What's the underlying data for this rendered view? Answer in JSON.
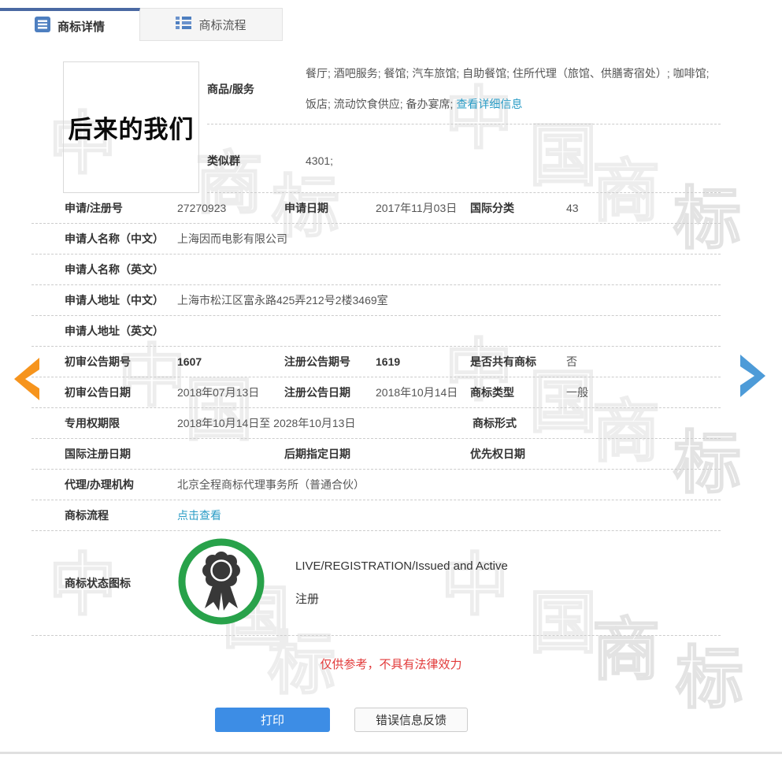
{
  "tabs": [
    {
      "label": "商标详情",
      "active": true
    },
    {
      "label": "商标流程",
      "active": false
    }
  ],
  "trademark": {
    "name": "后来的我们"
  },
  "goods": {
    "label": "商品/服务",
    "line1": "餐厅; 酒吧服务; 餐馆; 汽车旅馆; 自助餐馆; 住所代理（旅馆、供膳寄宿处）; 咖啡馆;",
    "line2": "饭店; 流动饮食供应; 备办宴席; ",
    "detail_link": "查看详细信息"
  },
  "similar_group": {
    "label": "类似群",
    "value": "4301;"
  },
  "fields": {
    "reg_no": {
      "label": "申请/注册号",
      "value": "27270923"
    },
    "app_date": {
      "label": "申请日期",
      "value": "2017年11月03日"
    },
    "intl_class": {
      "label": "国际分类",
      "value": "43"
    },
    "applicant_cn": {
      "label": "申请人名称（中文）",
      "value": "上海因而电影有限公司"
    },
    "applicant_en": {
      "label": "申请人名称（英文）",
      "value": ""
    },
    "address_cn": {
      "label": "申请人地址（中文）",
      "value": "上海市松江区富永路425弄212号2楼3469室"
    },
    "address_en": {
      "label": "申请人地址（英文）",
      "value": ""
    },
    "first_trial_no": {
      "label": "初审公告期号",
      "value": "1607"
    },
    "reg_announce_no": {
      "label": "注册公告期号",
      "value": "1619"
    },
    "shared_mark": {
      "label": "是否共有商标",
      "value": "否"
    },
    "first_trial_date": {
      "label": "初审公告日期",
      "value": "2018年07月13日"
    },
    "reg_announce_date": {
      "label": "注册公告日期",
      "value": "2018年10月14日"
    },
    "mark_type": {
      "label": "商标类型",
      "value": "一般"
    },
    "exclusive_period": {
      "label": "专用权期限",
      "value": "2018年10月14日至 2028年10月13日"
    },
    "mark_form": {
      "label": "商标形式",
      "value": ""
    },
    "intl_reg_date": {
      "label": "国际注册日期",
      "value": ""
    },
    "later_designation_date": {
      "label": "后期指定日期",
      "value": ""
    },
    "priority_date": {
      "label": "优先权日期",
      "value": ""
    },
    "agency": {
      "label": "代理/办理机构",
      "value": "北京全程商标代理事务所（普通合伙）"
    },
    "process": {
      "label": "商标流程",
      "link": "点击查看"
    },
    "status": {
      "label": "商标状态图标",
      "line1": "LIVE/REGISTRATION/Issued and Active",
      "line2": "注册"
    }
  },
  "footer": {
    "disclaimer": "仅供参考，不具有法律效力",
    "print_label": "打印",
    "feedback_label": "错误信息反馈"
  },
  "icons": {
    "status_badge": "award-ribbon",
    "nav_left": "chevron-left",
    "nav_right": "chevron-right"
  },
  "colors": {
    "tab_accent": "#4a69a3",
    "link": "#2a9cc6",
    "print_button": "#3d8de5",
    "badge_ring": "#28a24a",
    "disclaimer": "#e23a3a",
    "arrow_left": "#f6941d",
    "arrow_right": "#4d9bd8"
  },
  "watermark": {
    "chars": [
      "中",
      "国",
      "商",
      "标"
    ]
  }
}
